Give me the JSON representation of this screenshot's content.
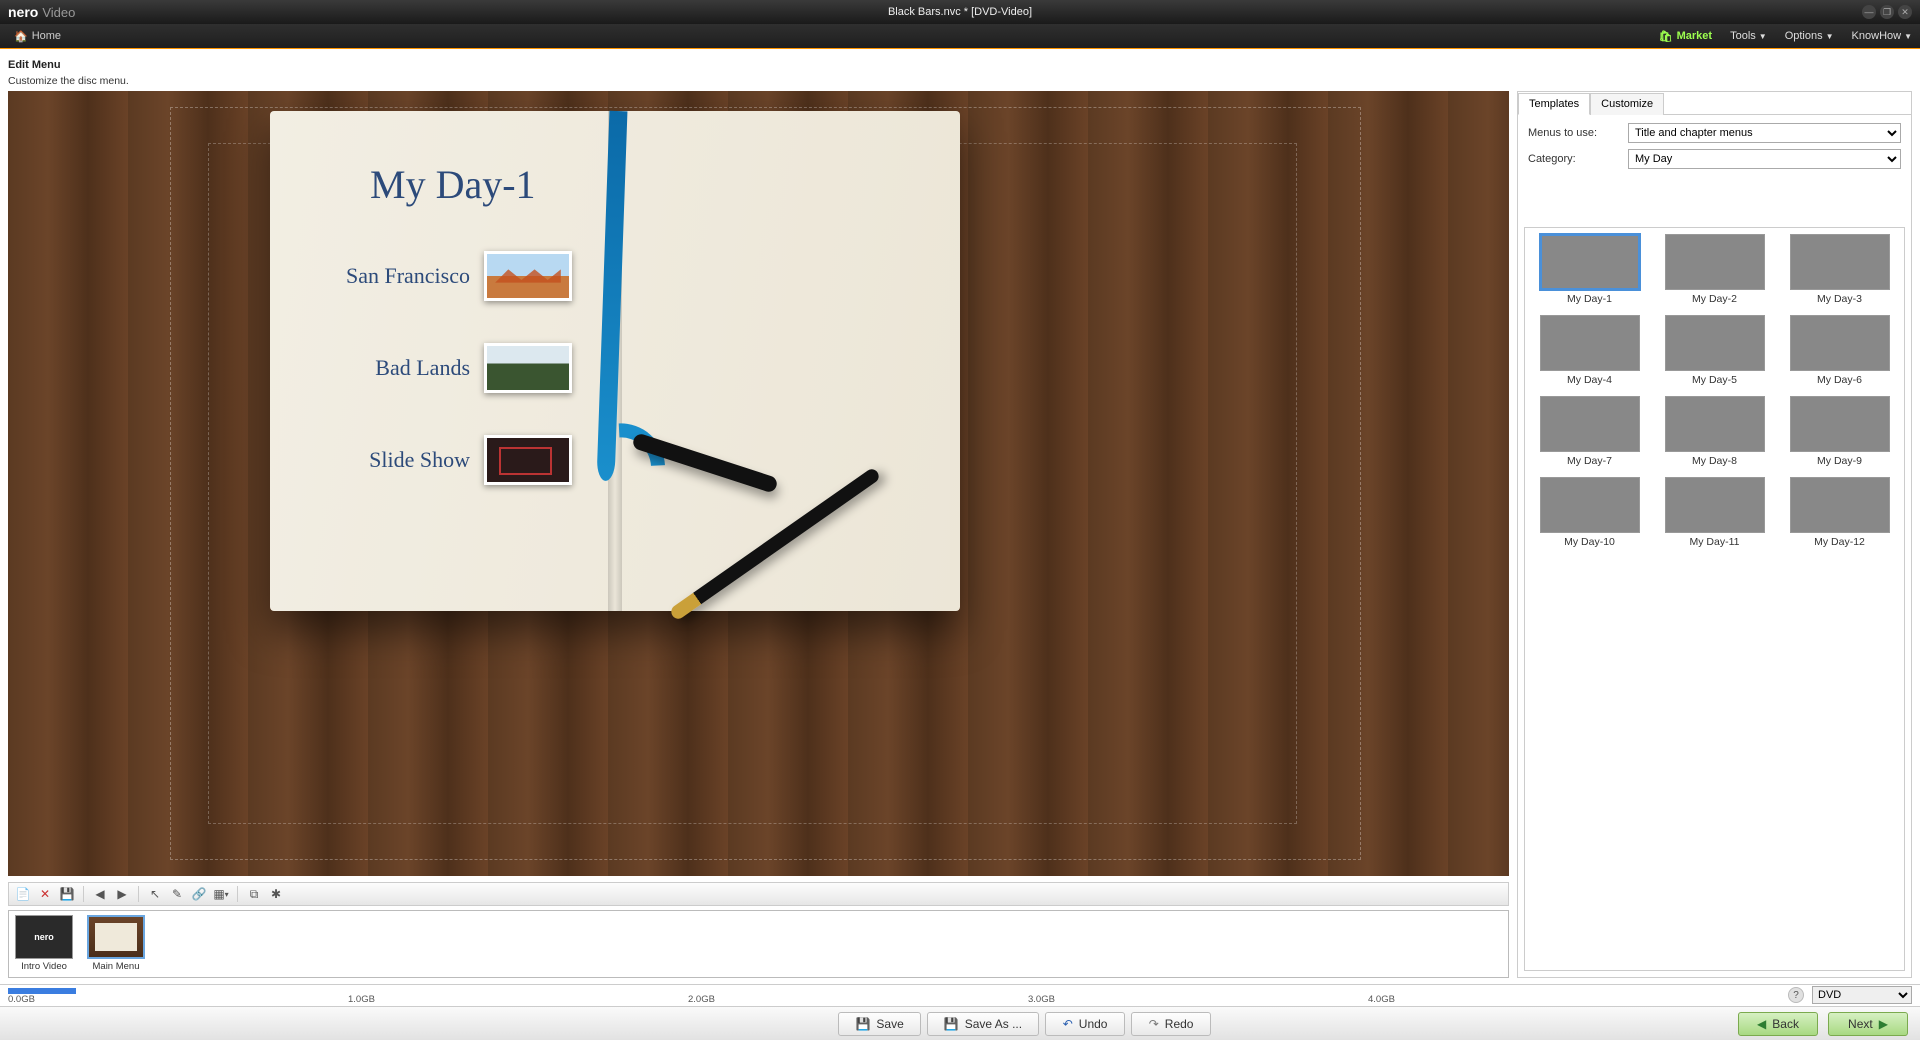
{
  "app": {
    "brand": "nero",
    "name": "Video",
    "document": "Black Bars.nvc * [DVD-Video]"
  },
  "menubar": {
    "home": "Home",
    "market": "Market",
    "tools": "Tools",
    "options": "Options",
    "knowhow": "KnowHow"
  },
  "heading": {
    "title": "Edit Menu",
    "subtitle": "Customize the disc menu."
  },
  "preview_menu": {
    "title": "My Day-1",
    "items": [
      {
        "label": "San Francisco"
      },
      {
        "label": "Bad Lands"
      },
      {
        "label": "Slide Show"
      }
    ]
  },
  "thumb_strip": [
    {
      "id": "intro",
      "label": "Intro Video",
      "brand": "nero"
    },
    {
      "id": "main",
      "label": "Main Menu"
    }
  ],
  "sidebar": {
    "tabs": {
      "templates": "Templates",
      "customize": "Customize"
    },
    "menus_label": "Menus to use:",
    "menus_value": "Title and chapter menus",
    "category_label": "Category:",
    "category_value": "My Day",
    "templates": [
      {
        "id": 1,
        "label": "My Day-1"
      },
      {
        "id": 2,
        "label": "My Day-2"
      },
      {
        "id": 3,
        "label": "My Day-3"
      },
      {
        "id": 4,
        "label": "My Day-4"
      },
      {
        "id": 5,
        "label": "My Day-5"
      },
      {
        "id": 6,
        "label": "My Day-6"
      },
      {
        "id": 7,
        "label": "My Day-7"
      },
      {
        "id": 8,
        "label": "My Day-8"
      },
      {
        "id": 9,
        "label": "My Day-9"
      },
      {
        "id": 10,
        "label": "My Day-10"
      },
      {
        "id": 11,
        "label": "My Day-11"
      },
      {
        "id": 12,
        "label": "My Day-12"
      }
    ],
    "selected_template": 1
  },
  "capacity": {
    "ticks": [
      "0.0GB",
      "1.0GB",
      "2.0GB",
      "3.0GB",
      "4.0GB"
    ],
    "format": "DVD"
  },
  "actions": {
    "save": "Save",
    "save_as": "Save As ...",
    "undo": "Undo",
    "redo": "Redo",
    "back": "Back",
    "next": "Next"
  }
}
